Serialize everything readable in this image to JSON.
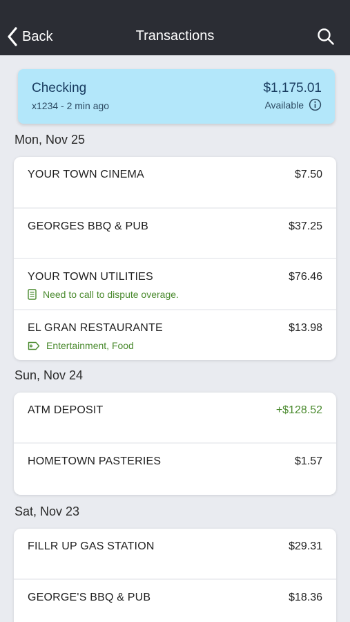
{
  "nav": {
    "back_label": "Back",
    "title": "Transactions"
  },
  "account": {
    "name": "Checking",
    "subtitle": "x1234 - 2 min ago",
    "balance": "$1,175.01",
    "balance_label": "Available"
  },
  "colors": {
    "navbar": "#2b2d34",
    "account_card": "#b3e7fa",
    "credit_green": "#4a8a2e",
    "background": "#e9ebf0"
  },
  "groups": [
    {
      "date": "Mon, Nov 25",
      "transactions": [
        {
          "merchant": "YOUR TOWN CINEMA",
          "amount": "$7.50"
        },
        {
          "merchant": "GEORGES BBQ & PUB",
          "amount": "$37.25"
        },
        {
          "merchant": "YOUR TOWN UTILITIES",
          "amount": "$76.46",
          "note": "Need to call to dispute overage.",
          "note_icon": "memo-icon"
        },
        {
          "merchant": "EL GRAN RESTAURANTE",
          "amount": "$13.98",
          "note": "Entertainment, Food",
          "note_icon": "tag-icon"
        }
      ]
    },
    {
      "date": "Sun, Nov 24",
      "transactions": [
        {
          "merchant": "ATM DEPOSIT",
          "amount": "+$128.52",
          "type": "credit"
        },
        {
          "merchant": "HOMETOWN PASTERIES",
          "amount": "$1.57"
        }
      ]
    },
    {
      "date": "Sat, Nov 23",
      "transactions": [
        {
          "merchant": "FILLR UP GAS STATION",
          "amount": "$29.31"
        },
        {
          "merchant": "GEORGE'S BBQ & PUB",
          "amount": "$18.36"
        }
      ]
    }
  ]
}
